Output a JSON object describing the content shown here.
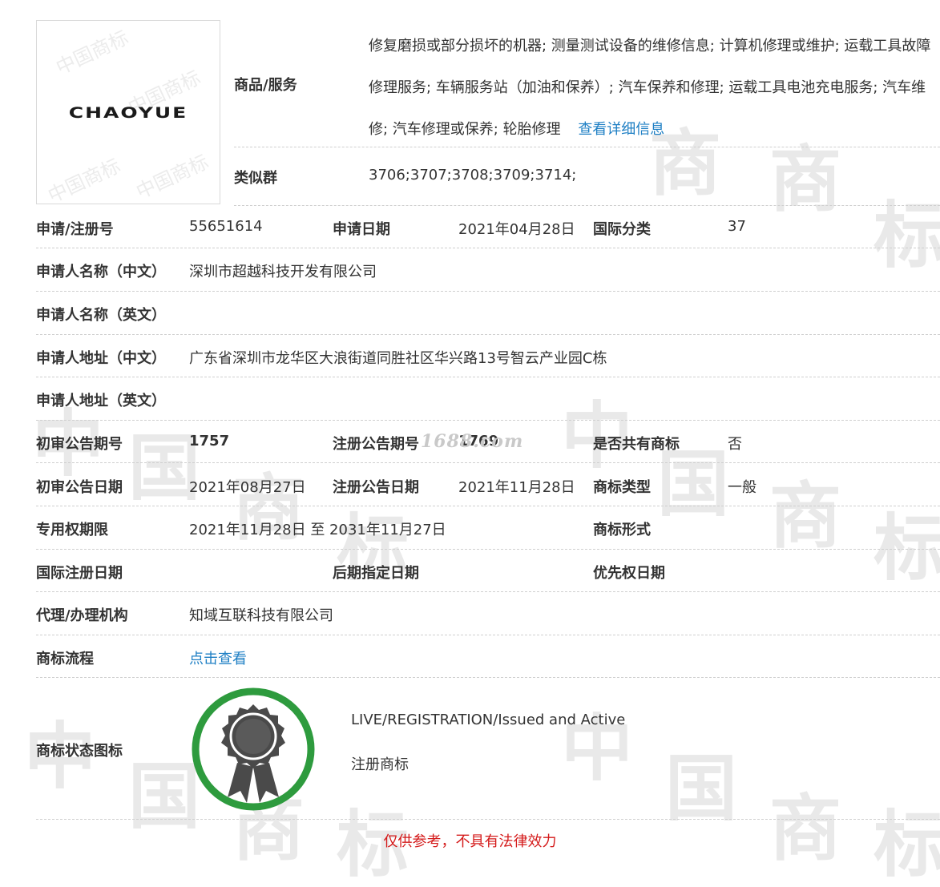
{
  "logo": {
    "text": "CHAOYUE",
    "watermark": "中国商标"
  },
  "goods_services": {
    "label": "商品/服务",
    "text": "修复磨损或部分损坏的机器; 测量测试设备的维修信息; 计算机修理或维护; 运载工具故障修理服务; 车辆服务站（加油和保养）; 汽车保养和修理; 运载工具电池充电服务; 汽车维修; 汽车修理或保养; 轮胎修理",
    "detail_link": "查看详细信息"
  },
  "similar_group": {
    "label": "类似群",
    "value": "3706;3707;3708;3709;3714;"
  },
  "rows": {
    "reg_no_label": "申请/注册号",
    "reg_no": "55651614",
    "apply_date_label": "申请日期",
    "apply_date": "2021年04月28日",
    "intl_class_label": "国际分类",
    "intl_class": "37",
    "applicant_cn_label": "申请人名称（中文）",
    "applicant_cn": "深圳市超越科技开发有限公司",
    "applicant_en_label": "申请人名称（英文）",
    "applicant_en": "",
    "address_cn_label": "申请人地址（中文）",
    "address_cn": "广东省深圳市龙华区大浪街道同胜社区华兴路13号智云产业园C栋",
    "address_en_label": "申请人地址（英文）",
    "address_en": "",
    "prelim_no_label": "初审公告期号",
    "prelim_no": "1757",
    "reg_pub_no_label": "注册公告期号",
    "reg_pub_no": "1769",
    "shared_label": "是否共有商标",
    "shared": "否",
    "prelim_date_label": "初审公告日期",
    "prelim_date": "2021年08月27日",
    "reg_pub_date_label": "注册公告日期",
    "reg_pub_date": "2021年11月28日",
    "tm_type_label": "商标类型",
    "tm_type": "一般",
    "exclusive_label": "专用权期限",
    "exclusive": "2021年11月28日 至 2031年11月27日",
    "tm_form_label": "商标形式",
    "tm_form": "",
    "intl_reg_date_label": "国际注册日期",
    "intl_reg_date": "",
    "later_designation_label": "后期指定日期",
    "later_designation": "",
    "priority_label": "优先权日期",
    "priority": "",
    "agent_label": "代理/办理机构",
    "agent": "知域互联科技有限公司",
    "process_label": "商标流程",
    "process_link": "点击查看"
  },
  "status": {
    "label": "商标状态图标",
    "line1": "LIVE/REGISTRATION/Issued and Active",
    "line2": "注册商标",
    "ring_color": "#2e9b3e",
    "seal_color": "#4a4a4a"
  },
  "footer": {
    "note": "仅供参考，不具有法律效力"
  },
  "watermark": {
    "site": "1688.com",
    "chars": [
      "商",
      "标",
      "中",
      "国"
    ]
  },
  "colors": {
    "link": "#1e7fc4",
    "note": "#d41a1a",
    "divider": "#cfcfcf"
  }
}
